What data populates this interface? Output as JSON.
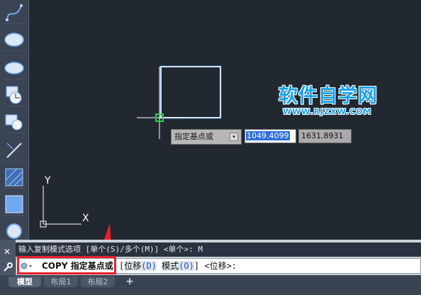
{
  "watermark": {
    "title": "软件自学网",
    "url": "WWW.RJZXW.COM"
  },
  "dynamic_input": {
    "prompt": "指定基点或",
    "dropdown_glyph": "▾",
    "x_value": "1049.4099",
    "y_value": "1631.8931"
  },
  "command_history": {
    "text": "输入复制模式选项 [单个(S)/多个(M)] <单个>: M"
  },
  "command_line": {
    "command_name": "COPY",
    "prompt": "指定基点或",
    "bracket_open": "[",
    "option1": "位移",
    "option1_key": "(D)",
    "option2": "模式",
    "option2_key": "(O)",
    "bracket_close": "]",
    "default": "<位移>:"
  },
  "layout_tabs": {
    "tabs": [
      {
        "label": "模型",
        "active": true
      },
      {
        "label": "布局1",
        "active": false
      },
      {
        "label": "布局2",
        "active": false
      }
    ],
    "add_label": "+"
  },
  "cmd_handle": {
    "close_glyph": "✕"
  },
  "axis_labels": {
    "x": "X",
    "y": "Y"
  },
  "toolbar": {
    "tools": [
      "spline-icon",
      "ellipse-icon",
      "ellipse-arc-icon",
      "insert-block-icon",
      "make-block-icon",
      "point-icon",
      "hatch-icon",
      "gradient-icon",
      "region-icon"
    ]
  },
  "colors": {
    "canvas_bg": "#212830",
    "accent_blue": "#1aa3e8",
    "highlight_red": "#e8202a"
  }
}
